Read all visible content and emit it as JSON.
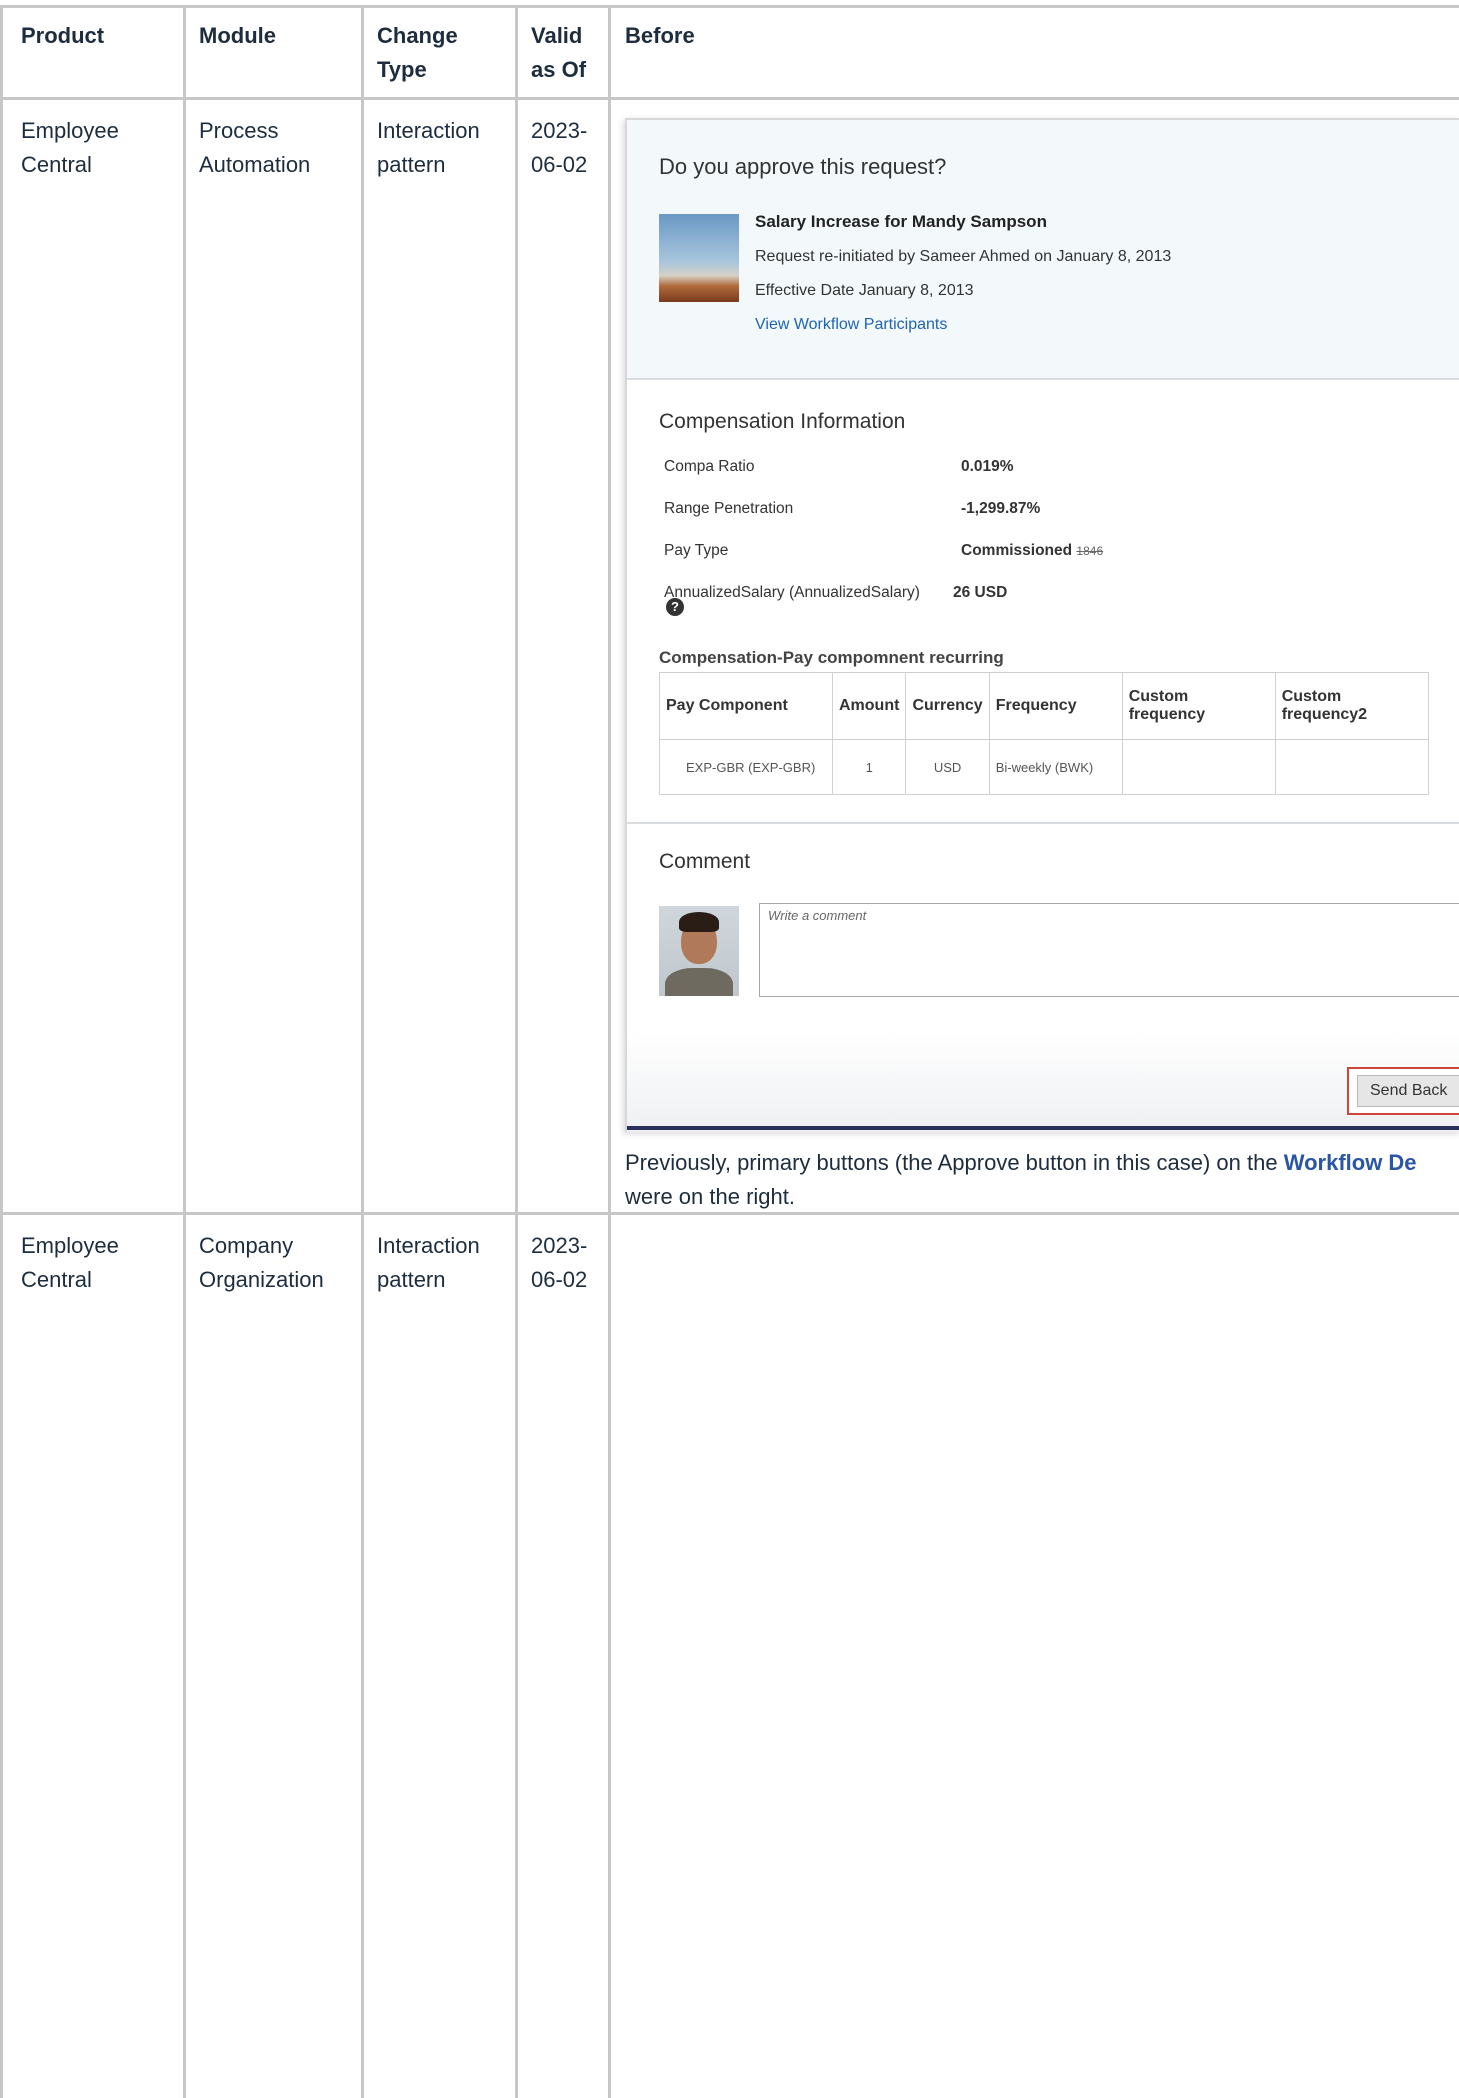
{
  "headers": [
    "Product",
    "Module",
    "Change\nType",
    "Valid\nas Of",
    "Before"
  ],
  "headers_lines": {
    "product": "Product",
    "module": "Module",
    "change_type_1": "Change",
    "change_type_2": "Type",
    "valid_1": "Valid",
    "valid_2": "as Of",
    "before": "Before"
  },
  "rows": [
    {
      "product_1": "Employee",
      "product_2": "Central",
      "module_1": "Process",
      "module_2": "Automation",
      "change_1": "Interaction",
      "change_2": "pattern",
      "date_1": "2023-",
      "date_2": "06-02"
    },
    {
      "product_1": "Employee",
      "product_2": "Central",
      "module_1": "Company",
      "module_2": "Organization",
      "change_1": "Interaction",
      "change_2": "pattern",
      "date_1": "2023-",
      "date_2": "06-02"
    }
  ],
  "screenshot": {
    "question": "Do you approve this request?",
    "title": "Salary Increase for Mandy Sampson",
    "reinitiated": "Request re-initiated by Sameer Ahmed on January 8, 2013",
    "effective": "Effective Date  January 8, 2013",
    "view_participants": "View Workflow Participants",
    "comp_title": "Compensation Information",
    "fields": [
      {
        "label": "Compa Ratio",
        "value": "0.019%"
      },
      {
        "label": "Range Penetration",
        "value": "-1,299.87%"
      },
      {
        "label": "Pay Type",
        "value": "Commissioned",
        "old": "1846"
      },
      {
        "label": "AnnualizedSalary (AnnualizedSalary)",
        "value": "26 USD"
      }
    ],
    "help_glyph": "?",
    "pay_section_title": "Compensation-Pay compomnent recurring",
    "pay_headers": [
      "Pay Component",
      "Amount",
      "Currency",
      "Frequency",
      "Custom frequency",
      "Custom frequency2"
    ],
    "pay_row": [
      "EXP-GBR (EXP-GBR)",
      "1",
      "USD",
      "Bi-weekly (BWK)",
      "",
      ""
    ],
    "comment_title": "Comment",
    "comment_placeholder": "Write a comment",
    "send_back": "Send Back"
  },
  "caption": {
    "line1_pre": "Previously, primary buttons (the Approve button in this case) on the ",
    "line1_link": "Workflow De",
    "line2": "were on the right."
  },
  "colors": {
    "grid": "#c7c7c7",
    "link": "#2956a6",
    "highlight": "#d0453a"
  }
}
